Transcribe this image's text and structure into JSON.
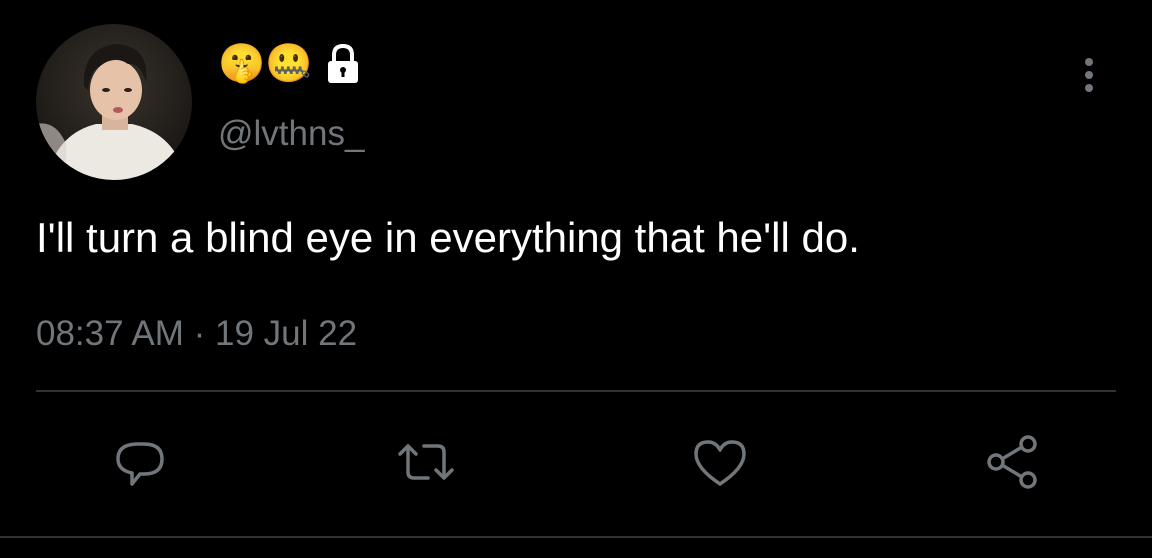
{
  "tweet": {
    "display_name_emojis": "🤫🤐",
    "lock_icon": "lock-icon",
    "handle": "@lvthns_",
    "text": "I'll turn a blind eye in everything that he'll do.",
    "timestamp": "08:37 AM · 19 Jul 22"
  },
  "actions": [
    {
      "name": "reply",
      "icon": "speech-bubble-icon"
    },
    {
      "name": "retweet",
      "icon": "retweet-icon"
    },
    {
      "name": "like",
      "icon": "heart-icon"
    },
    {
      "name": "share",
      "icon": "share-icon"
    }
  ],
  "colors": {
    "background": "#000000",
    "text_primary": "#ffffff",
    "text_secondary": "#71767b",
    "divider": "#2f3336",
    "icon": "#71767b"
  }
}
